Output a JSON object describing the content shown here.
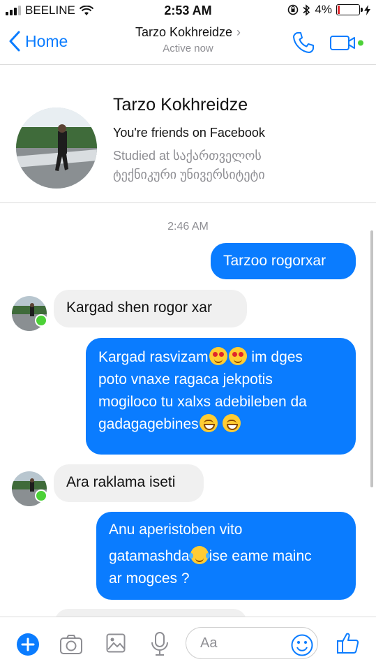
{
  "status": {
    "carrier": "BEELINE",
    "time": "2:53 AM",
    "battery": "4%"
  },
  "nav": {
    "back_label": "Home",
    "title": "Tarzo Kokhreidze",
    "subtitle": "Active now"
  },
  "profile": {
    "name": "Tarzo Kokhreidze",
    "friends": "You're friends on Facebook",
    "studied": "Studied at საქართველოს ტექნიკური უნივერსიტეტი"
  },
  "chat": {
    "timestamp": "2:46 AM",
    "messages": [
      {
        "dir": "out",
        "parts": [
          "Tarzoo rogorxar"
        ]
      },
      {
        "dir": "in",
        "parts": [
          "Kargad shen rogor xar"
        ]
      },
      {
        "dir": "out",
        "parts": [
          "Kargad rasvizam",
          "im dges",
          "poto vnaxe ragaca jekpotis",
          "mogiloco tu xalxs adebileben da",
          "gadagagebines"
        ]
      },
      {
        "dir": "in",
        "parts": [
          "Ara raklama iseti"
        ]
      },
      {
        "dir": "out",
        "parts": [
          "Anu aperistoben vito",
          "gatamashda",
          "ise eame mainc",
          "ar mogces ?"
        ]
      }
    ]
  },
  "composer": {
    "placeholder": "Aa"
  },
  "colors": {
    "accent": "#0a7cff",
    "incoming_bubble": "#f0f0f0",
    "online": "#4cd137"
  }
}
